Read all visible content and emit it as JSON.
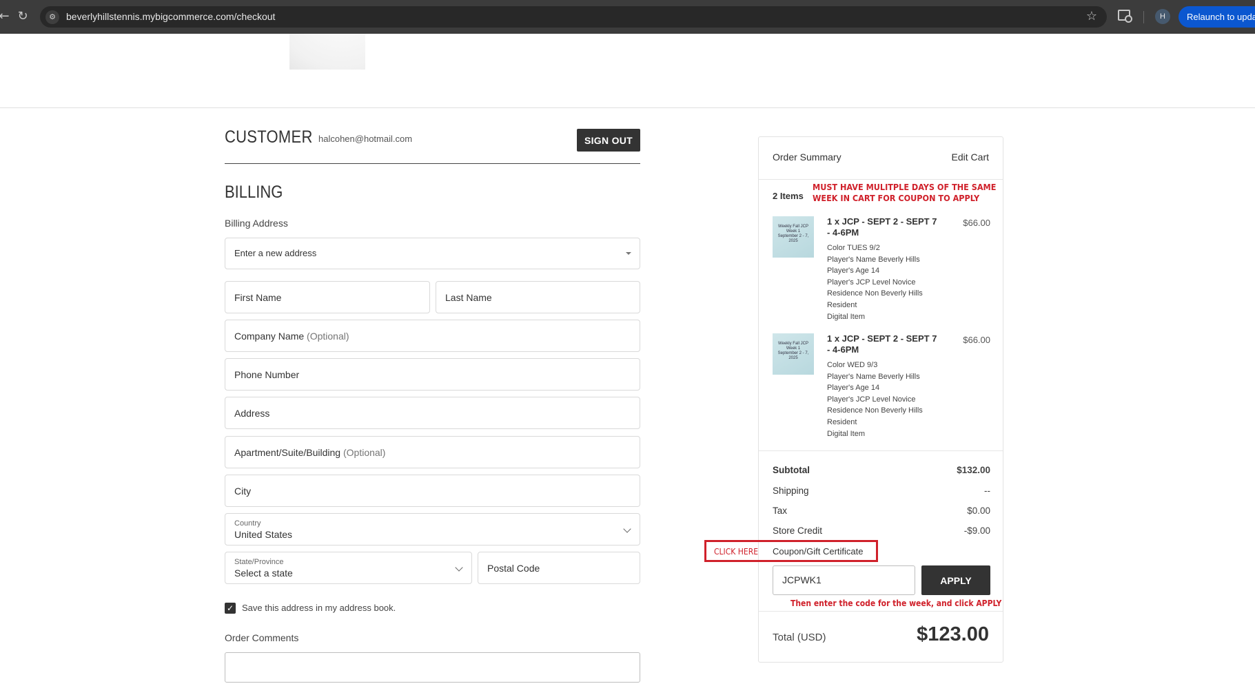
{
  "browser": {
    "url": "beverlyhillstennis.mybigcommerce.com/checkout",
    "profile_initial": "H",
    "relaunch_label": "Relaunch to update"
  },
  "customer": {
    "title": "CUSTOMER",
    "email": "halcohen@hotmail.com",
    "sign_out_label": "SIGN OUT"
  },
  "billing": {
    "title": "BILLING",
    "address_label": "Billing Address",
    "address_select": "Enter a new address",
    "first_name": "First Name",
    "last_name": "Last Name",
    "company": "Company Name",
    "optional": "(Optional)",
    "phone": "Phone Number",
    "address": "Address",
    "apartment": "Apartment/Suite/Building",
    "city": "City",
    "country_label": "Country",
    "country_value": "United States",
    "state_label": "State/Province",
    "state_value": "Select a state",
    "postal": "Postal Code",
    "save_address_label": "Save this address in my address book.",
    "save_address_checked": true,
    "comments_label": "Order Comments"
  },
  "summary": {
    "title": "Order Summary",
    "edit_cart": "Edit Cart",
    "item_count": "2 Items",
    "items": [
      {
        "name": "1 x JCP - SEPT 2 - SEPT 7 - 4-6PM",
        "price": "$66.00",
        "thumb_text": "Weekly Fall JCP Week 1 September 2 - 7, 2025",
        "options": [
          "Color TUES 9/2",
          "Player's Name Beverly Hills",
          "Player's Age 14",
          "Player's JCP Level Novice",
          "Residence Non Beverly Hills Resident",
          "Digital Item"
        ]
      },
      {
        "name": "1 x JCP - SEPT 2 - SEPT 7 - 4-6PM",
        "price": "$66.00",
        "thumb_text": "Weekly Fall JCP Week 1 September 2 - 7, 2025",
        "options": [
          "Color WED 9/3",
          "Player's Name Beverly Hills",
          "Player's Age 14",
          "Player's JCP Level Novice",
          "Residence Non Beverly Hills Resident",
          "Digital Item"
        ]
      }
    ],
    "subtotal_label": "Subtotal",
    "subtotal_value": "$132.00",
    "shipping_label": "Shipping",
    "shipping_value": "--",
    "tax_label": "Tax",
    "tax_value": "$0.00",
    "store_credit_label": "Store Credit",
    "store_credit_value": "-$9.00",
    "coupon_label": "Coupon/Gift Certificate",
    "coupon_value": "JCPWK1",
    "apply_label": "APPLY",
    "total_label": "Total (USD)",
    "total_value": "$123.00"
  },
  "annotations": {
    "top_note": "MUST HAVE MULITPLE DAYS OF THE SAME WEEK IN CART FOR COUPON TO APPLY",
    "click_here": "CLICK HERE",
    "bottom_note": "Then enter the code for the week, and click APPLY",
    "color": "#d0212b"
  }
}
